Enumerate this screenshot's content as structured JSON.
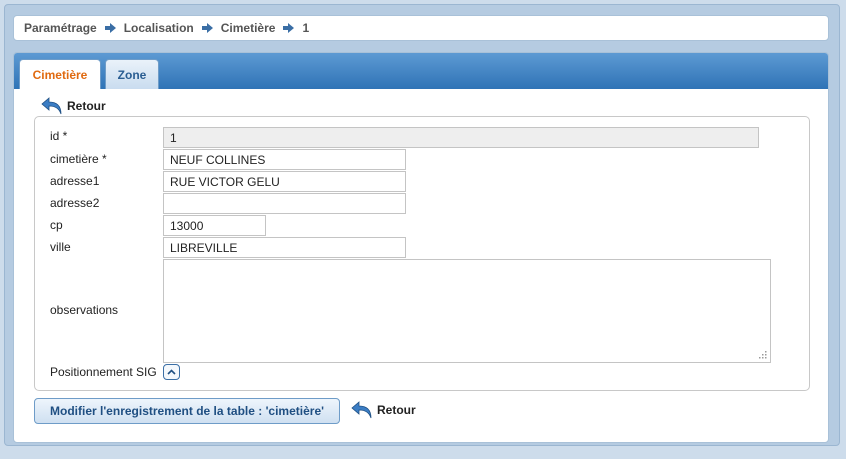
{
  "breadcrumb": {
    "items": [
      "Paramétrage",
      "Localisation",
      "Cimetière",
      "1"
    ]
  },
  "tabs": [
    {
      "label": "Cimetière",
      "active": true
    },
    {
      "label": "Zone",
      "active": false
    }
  ],
  "retour_label": "Retour",
  "form": {
    "id": {
      "label": "id *",
      "value": "1"
    },
    "cimetiere": {
      "label": "cimetière *",
      "value": "NEUF COLLINES"
    },
    "adresse1": {
      "label": "adresse1",
      "value": "RUE VICTOR GELU"
    },
    "adresse2": {
      "label": "adresse2",
      "value": ""
    },
    "cp": {
      "label": "cp",
      "value": "13000"
    },
    "ville": {
      "label": "ville",
      "value": "LIBREVILLE"
    },
    "observations": {
      "label": "observations",
      "value": ""
    },
    "sig": {
      "label": "Positionnement SIG"
    }
  },
  "submit_label": "Modifier l'enregistrement de la table : 'cimetière'",
  "colors": {
    "tab_active_text": "#e06a10",
    "tab_bar": "#3a7fc1",
    "link_blue": "#1f4f82"
  }
}
